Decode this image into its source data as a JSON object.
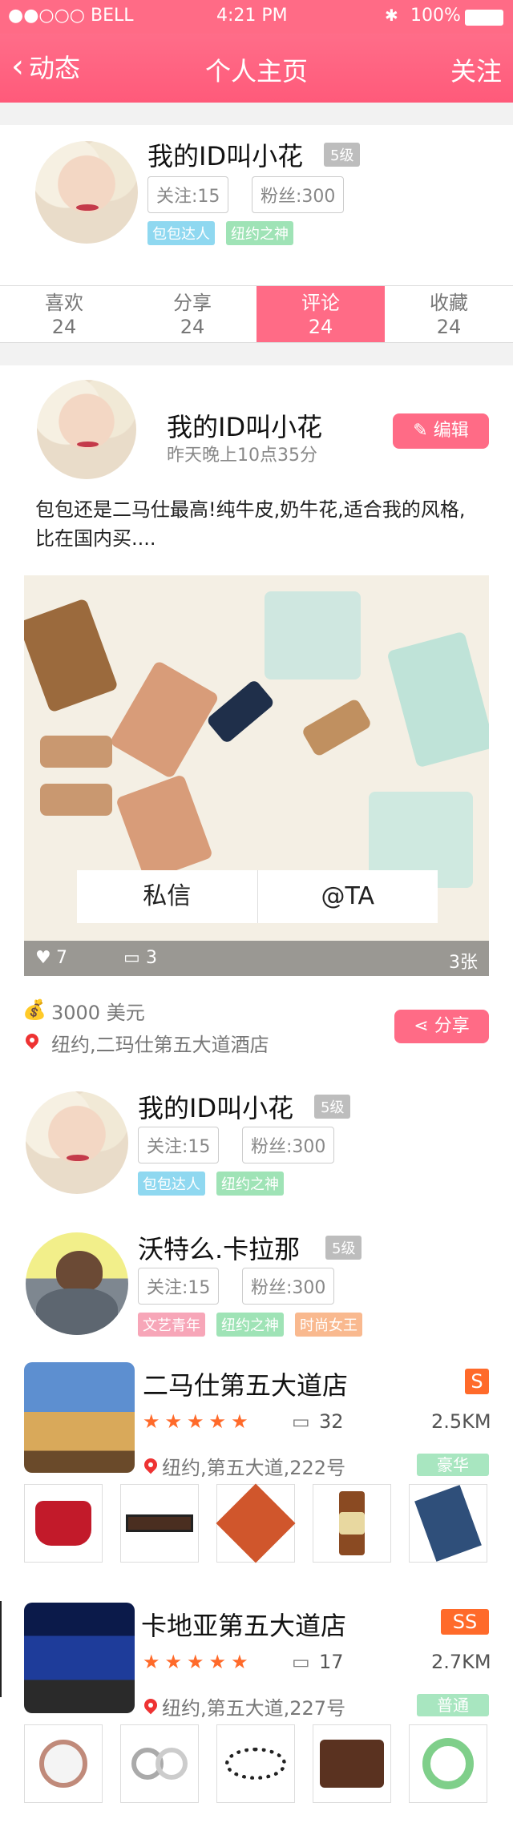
{
  "status": {
    "carrier": "●●○○○ BELL",
    "time": "4:21 PM",
    "battery": "100%"
  },
  "nav": {
    "back_label": "动态",
    "title": "个人主页",
    "action": "关注"
  },
  "profile": {
    "name": "我的ID叫小花",
    "level": "5级",
    "following": "关注:15",
    "fans": "粉丝:300",
    "tags": [
      "包包达人",
      "纽约之神"
    ]
  },
  "tabs": [
    {
      "label": "喜欢",
      "count": "24"
    },
    {
      "label": "分享",
      "count": "24"
    },
    {
      "label": "评论",
      "count": "24"
    },
    {
      "label": "收藏",
      "count": "24"
    }
  ],
  "post": {
    "author": "我的ID叫小花",
    "time": "昨天晚上10点35分",
    "edit_label": "编辑",
    "text": "包包还是二马仕最高!纯牛皮,奶牛花,适合我的风格,比在国内买....",
    "message_label": "私信",
    "at_label": "@TA",
    "likes": "7",
    "comments": "3",
    "photo_count": "3张",
    "price": "3000  美元",
    "location": "纽约,二玛仕第五大道酒店",
    "share_label": "分享"
  },
  "users": [
    {
      "name": "我的ID叫小花",
      "level": "5级",
      "following": "关注:15",
      "fans": "粉丝:300",
      "tags": [
        "包包达人",
        "纽约之神"
      ]
    },
    {
      "name": "沃特么.卡拉那",
      "level": "5级",
      "following": "关注:15",
      "fans": "粉丝:300",
      "tags": [
        "文艺青年",
        "纽约之神",
        "时尚女王"
      ]
    }
  ],
  "stores": [
    {
      "name": "二马仕第五大道店",
      "rank": "S",
      "rating": 5,
      "reviews": "32",
      "distance": "2.5KM",
      "address": "纽约,第五大道,222号",
      "grade": "豪华"
    },
    {
      "name": "卡地亚第五大道店",
      "rank": "SS",
      "rating": 5,
      "reviews": "17",
      "distance": "2.7KM",
      "address": "纽约,第五大道,227号",
      "grade": "普通"
    }
  ],
  "colors": {
    "accent": "#ff6b86",
    "star": "#ff6a2a",
    "grade": "#a8e6c0",
    "tag_blue": "#8fd8f0",
    "tag_green": "#9fe3b6",
    "tag_pink": "#f7a6b8",
    "tag_orange": "#f9b98f"
  }
}
